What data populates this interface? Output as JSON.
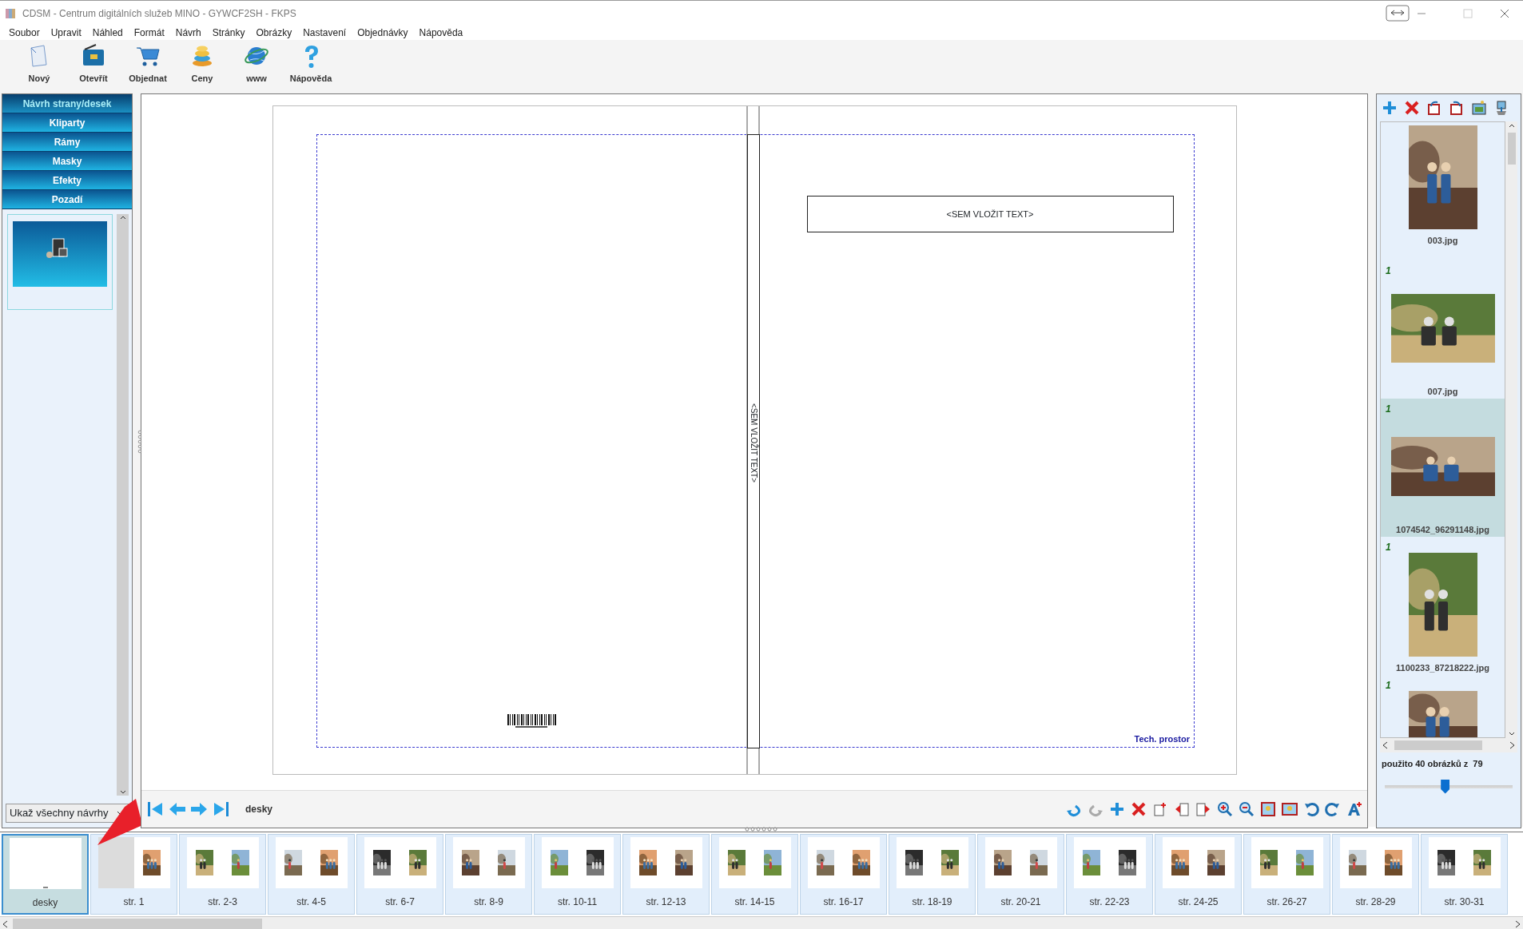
{
  "window": {
    "title": "CDSM - Centrum digitálních služeb MINO - GYWCF2SH - FKPS"
  },
  "menu": [
    "Soubor",
    "Upravit",
    "Náhled",
    "Formát",
    "Návrh",
    "Stránky",
    "Obrázky",
    "Nastavení",
    "Objednávky",
    "Nápověda"
  ],
  "toolbar": [
    {
      "label": "Nový"
    },
    {
      "label": "Otevřít"
    },
    {
      "label": "Objednat"
    },
    {
      "label": "Ceny"
    },
    {
      "label": "www"
    },
    {
      "label": "Nápověda"
    }
  ],
  "design_panel": {
    "sections": [
      {
        "label": "Návrh strany/desek",
        "selected": true
      },
      {
        "label": "Kliparty",
        "selected": false
      },
      {
        "label": "Rámy",
        "selected": false
      },
      {
        "label": "Masky",
        "selected": false
      },
      {
        "label": "Efekty",
        "selected": false
      },
      {
        "label": "Pozadí",
        "selected": false
      }
    ],
    "filter": {
      "value": "Ukaž všechny návrhy"
    }
  },
  "page": {
    "spine_text": "<SEM VLOŽIT TEXT>",
    "text_box": "<SEM VLOŽIT TEXT>",
    "tech_label": "Tech. prostor"
  },
  "navigation": {
    "current": "desky"
  },
  "images": {
    "items": [
      {
        "filename": "003.jpg",
        "selected": false,
        "kind": "portrait"
      },
      {
        "filename": "007.jpg",
        "badge": "1",
        "selected": false,
        "kind": "landscape"
      },
      {
        "filename": "1074542_96291148.jpg",
        "badge": "1",
        "selected": true,
        "kind": "wide"
      },
      {
        "filename": "1100233_87218222.jpg",
        "badge": "1",
        "selected": false,
        "kind": "portrait"
      },
      {
        "badge": "1",
        "selected": false,
        "kind": "cut"
      }
    ],
    "usage": "použito 40 obrázků z  79",
    "zoom": {
      "level": 0.47
    }
  },
  "pages": [
    {
      "label": "desky",
      "kind": "cover",
      "selected": true
    },
    {
      "label": "str. 1",
      "kind": "single",
      "selected": false
    },
    {
      "label": "str. 2-3",
      "kind": "spread",
      "selected": false
    },
    {
      "label": "str. 4-5",
      "kind": "spread",
      "selected": false
    },
    {
      "label": "str. 6-7",
      "kind": "spread",
      "selected": false
    },
    {
      "label": "str. 8-9",
      "kind": "spread",
      "selected": false
    },
    {
      "label": "str. 10-11",
      "kind": "spread",
      "selected": false
    },
    {
      "label": "str. 12-13",
      "kind": "spread",
      "selected": false
    },
    {
      "label": "str. 14-15",
      "kind": "spread",
      "selected": false
    },
    {
      "label": "str. 16-17",
      "kind": "spread",
      "selected": false
    },
    {
      "label": "str. 18-19",
      "kind": "spread",
      "selected": false
    },
    {
      "label": "str. 20-21",
      "kind": "spread",
      "selected": false
    },
    {
      "label": "str. 22-23",
      "kind": "spread",
      "selected": false
    },
    {
      "label": "str. 24-25",
      "kind": "spread",
      "selected": false
    },
    {
      "label": "str. 26-27",
      "kind": "spread",
      "selected": false
    },
    {
      "label": "str. 28-29",
      "kind": "spread",
      "selected": false
    },
    {
      "label": "str. 30-31",
      "kind": "spread",
      "selected": false
    }
  ]
}
